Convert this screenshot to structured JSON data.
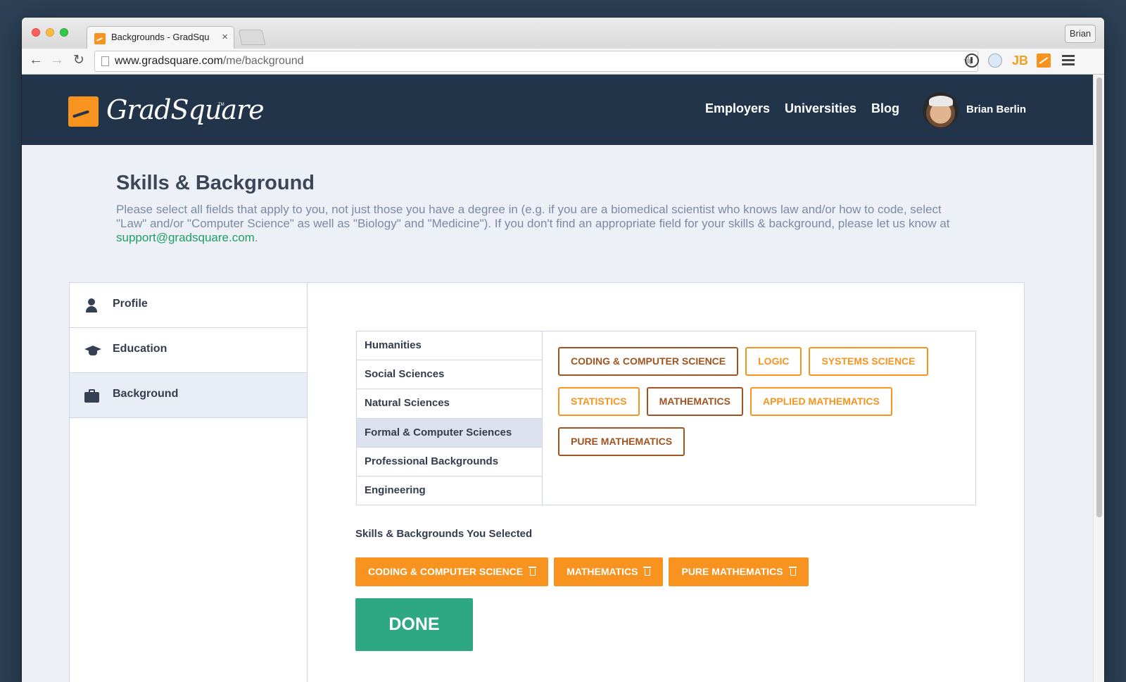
{
  "browser": {
    "tab_title": "Backgrounds - GradSquare",
    "tab_close": "×",
    "profile_name": "Brian",
    "url_host": "www.gradsquare.com",
    "url_path": "/me/background"
  },
  "header": {
    "logo_text": "GradSquare",
    "logo_tm": "TM",
    "nav": {
      "employers": "Employers",
      "universities": "Universities",
      "blog": "Blog"
    },
    "user_name": "Brian Berlin"
  },
  "page": {
    "title": "Skills & Background",
    "description": "Please select all fields that apply to you, not just those you have a degree in (e.g. if you are a biomedical scientist who knows law and/or how to code, select \"Law\" and/or \"Computer Science\" as well as \"Biology\" and \"Medicine\"). If you don't find an appropriate field for your skills & background, please let us know at ",
    "support_email": "support@gradsquare.com",
    "description_end": "."
  },
  "sidebar": {
    "items": [
      {
        "label": "Profile",
        "icon": "user-icon"
      },
      {
        "label": "Education",
        "icon": "graduation-cap-icon"
      },
      {
        "label": "Background",
        "icon": "briefcase-icon",
        "active": true
      }
    ]
  },
  "categories": {
    "items": [
      "Humanities",
      "Social Sciences",
      "Natural Sciences",
      "Formal & Computer Sciences",
      "Professional Backgrounds",
      "Engineering"
    ],
    "active": "Formal & Computer Sciences"
  },
  "tags": [
    {
      "label": "CODING & COMPUTER SCIENCE",
      "selected": true
    },
    {
      "label": "LOGIC",
      "selected": false
    },
    {
      "label": "SYSTEMS SCIENCE",
      "selected": false
    },
    {
      "label": "STATISTICS",
      "selected": false
    },
    {
      "label": "MATHEMATICS",
      "selected": true
    },
    {
      "label": "APPLIED MATHEMATICS",
      "selected": false
    },
    {
      "label": "PURE MATHEMATICS",
      "selected": true
    }
  ],
  "selected_section": {
    "heading": "Skills & Backgrounds You Selected",
    "chips": [
      "CODING & COMPUTER SCIENCE",
      "MATHEMATICS",
      "PURE MATHEMATICS"
    ]
  },
  "done_label": "DONE",
  "colors": {
    "header_bg": "#22344a",
    "accent_orange": "#f7931e",
    "selected_brown": "#a0531f",
    "done_green": "#2ea882",
    "email_green": "#1e9e63"
  }
}
